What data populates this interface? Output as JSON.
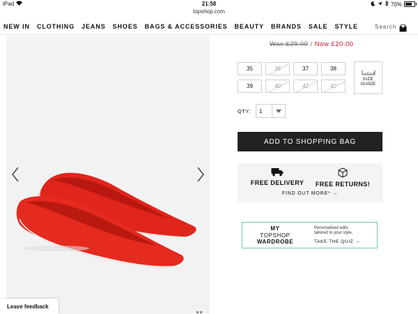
{
  "status_bar": {
    "device": "iPad",
    "time": "21:58",
    "battery": "70%"
  },
  "url": "topshop.com",
  "nav": {
    "items": [
      "NEW IN",
      "CLOTHING",
      "JEANS",
      "SHOES",
      "BAGS & ACCESSORIES",
      "BEAUTY",
      "BRANDS",
      "SALE",
      "STYLE"
    ],
    "search_label": "Search",
    "bag_count": "0"
  },
  "price": {
    "was": "Was £29.00",
    "separator": "/",
    "now": "Now £20.00"
  },
  "sizes": [
    {
      "label": "35",
      "available": true
    },
    {
      "label": "36",
      "available": false
    },
    {
      "label": "37",
      "available": true
    },
    {
      "label": "38",
      "available": true
    },
    {
      "label": "39",
      "available": true
    },
    {
      "label": "40",
      "available": false
    },
    {
      "label": "41",
      "available": false
    },
    {
      "label": "42",
      "available": false
    }
  ],
  "size_guide": {
    "line1": "SIZE",
    "line2": "GUIDE"
  },
  "quantity": {
    "label": "QTY:",
    "value": "1"
  },
  "add_to_bag": "ADD TO SHOPPING BAG",
  "delivery": {
    "free_delivery": "FREE DELIVERY",
    "free_returns": "FREE RETURNS!",
    "find_out_more": "FIND OUT MORE* →"
  },
  "wardrobe": {
    "my": "MY",
    "topshop": "TOPSHOP",
    "wardrobe": "WARDROBE",
    "desc_line1": "Personalised edits",
    "desc_line2": "tailored to your style.",
    "cta": "TAKE THE QUIZ →"
  },
  "feedback": "Leave feedback",
  "colors": {
    "sale_red": "#c8102e",
    "button_dark": "#222222",
    "wardrobe_border": "#6fc7b0",
    "shoe_red": "#e0251c"
  }
}
